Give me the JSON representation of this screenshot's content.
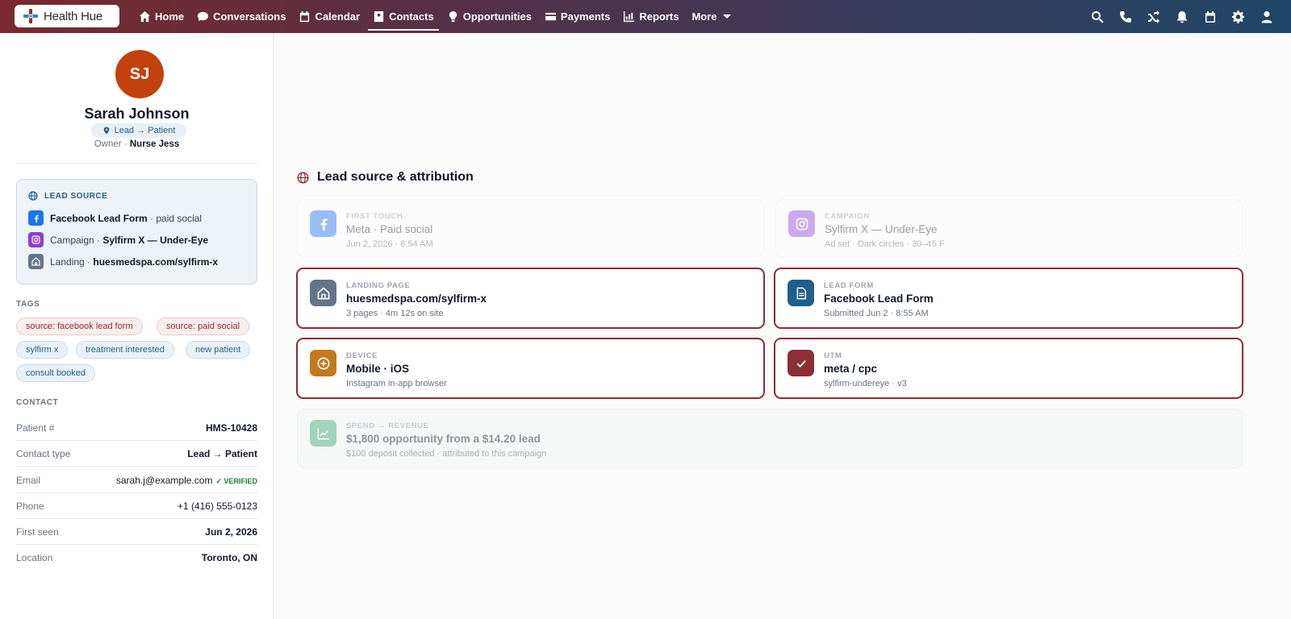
{
  "brand": {
    "name": "Health Hue"
  },
  "nav": {
    "items": [
      {
        "label": "Home",
        "icon": "home-icon"
      },
      {
        "label": "Conversations",
        "icon": "chat-icon"
      },
      {
        "label": "Calendar",
        "icon": "calendar-icon"
      },
      {
        "label": "Contacts",
        "icon": "contacts-icon",
        "active": true
      },
      {
        "label": "Opportunities",
        "icon": "lightbulb-icon"
      },
      {
        "label": "Payments",
        "icon": "card-icon"
      },
      {
        "label": "Reports",
        "icon": "chart-icon"
      },
      {
        "label": "More",
        "icon": "caret-down-icon"
      }
    ],
    "right_icons": [
      "search-icon",
      "phone-icon",
      "shuffle-icon",
      "bell-icon",
      "calendar-icon",
      "gear-icon",
      "user-icon"
    ]
  },
  "contact": {
    "initials": "SJ",
    "name": "Sarah Johnson",
    "status": "Lead → Patient",
    "owner_label": "Owner ·",
    "owner": "Nurse Jess"
  },
  "lead_source": {
    "title": "LEAD SOURCE",
    "rows": [
      {
        "bold": "Facebook Lead Form",
        "rest": " · paid social"
      },
      {
        "prefix": "Campaign · ",
        "bold": "Sylfirm X — Under-Eye"
      },
      {
        "prefix": "Landing · ",
        "bold": "huesmedspa.com/sylfirm-x"
      }
    ]
  },
  "tags": {
    "title": "TAGS",
    "items": [
      "source: facebook lead form",
      "source: paid social",
      "sylfirm x",
      "treatment interested",
      "new patient",
      "consult booked"
    ]
  },
  "contact_info": {
    "title": "CONTACT",
    "rows": [
      {
        "k": "Patient #",
        "v": "HMS-10428"
      },
      {
        "k": "Contact type",
        "v": "Lead → Patient"
      },
      {
        "k": "Email",
        "v": "sarah.j@example.com",
        "badge": "✓ VERIFIED"
      },
      {
        "k": "Phone",
        "v": "+1 (416) 555-0123"
      },
      {
        "k": "First seen",
        "v": "Jun 2, 2026"
      },
      {
        "k": "Location",
        "v": "Toronto, ON"
      }
    ]
  },
  "attribution": {
    "title": "Lead source & attribution",
    "first_touch": {
      "label": "FIRST TOUCH",
      "value": "Meta · Paid social",
      "sub": "Jun 2, 2026 · 8:54 AM"
    },
    "campaign": {
      "label": "CAMPAIGN",
      "value": "Sylfirm X — Under-Eye",
      "sub": "Ad set · Dark circles · 30–45 F"
    },
    "landing": {
      "label": "LANDING PAGE",
      "value": "huesmedspa.com/sylfirm-x",
      "sub": "3 pages · 4m 12s on site"
    },
    "lead_form": {
      "label": "LEAD FORM",
      "value": "Facebook Lead Form",
      "sub": "Submitted Jun 2 · 8:55 AM"
    },
    "device": {
      "label": "DEVICE",
      "value": "Mobile · iOS",
      "sub": "Instagram in-app browser"
    },
    "utm": {
      "label": "UTM",
      "value": "meta / cpc",
      "sub": "sylfirm-undereye · v3"
    },
    "spend": {
      "label": "SPEND → REVENUE",
      "value": "$1,800 opportunity from a $14.20 lead",
      "sub": "$100 deposit collected · attributed to this campaign"
    }
  },
  "colors": {
    "accent": "#8b2f35",
    "avatar": "#c2410c",
    "blue": "#1f5f8b"
  }
}
